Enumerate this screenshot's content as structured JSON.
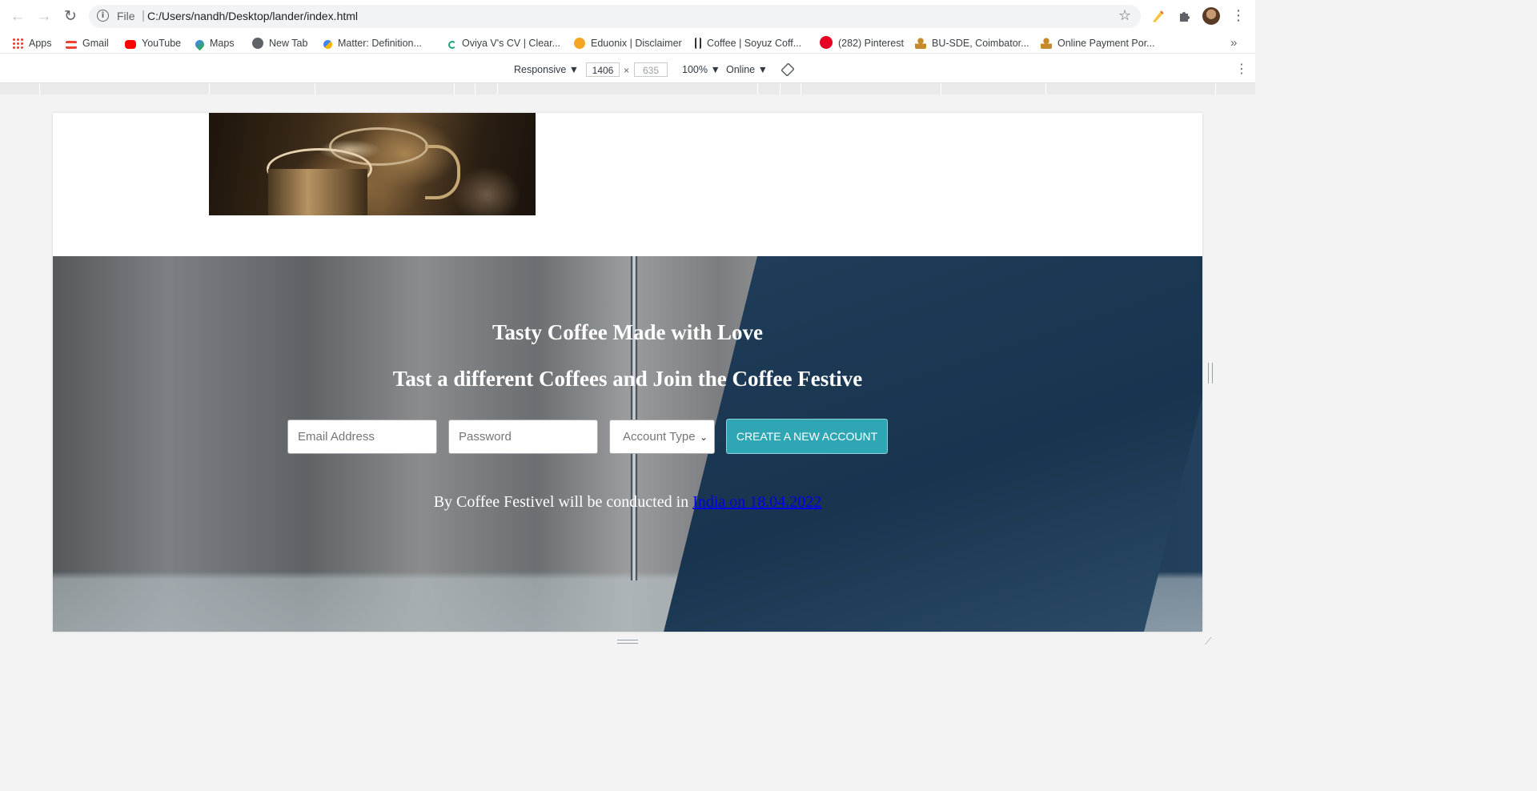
{
  "browser": {
    "omnibox": {
      "scheme": "File",
      "url": "C:/Users/nandh/Desktop/lander/index.html"
    },
    "icons": {
      "back": "arrow-left-icon",
      "forward": "arrow-right-icon",
      "reload": "reload-icon",
      "bookmark": "star-icon",
      "extensions": "puzzle-icon",
      "menu": "more-vert-icon"
    }
  },
  "bookmarks": [
    {
      "label": "Apps",
      "icon": "apps-grid-icon",
      "color": "#ea4335"
    },
    {
      "label": "Gmail",
      "icon": "gmail-icon",
      "color": "#ea4335"
    },
    {
      "label": "YouTube",
      "icon": "youtube-icon",
      "color": "#ff0000"
    },
    {
      "label": "Maps",
      "icon": "maps-pin-icon",
      "color": "#34a853"
    },
    {
      "label": "New Tab",
      "icon": "globe-icon",
      "color": "#5f6368"
    },
    {
      "label": "Matter: Definition...",
      "icon": "site-icon",
      "color": "#f4b400"
    },
    {
      "label": "Oviya V's CV | Clear...",
      "icon": "site-icon",
      "color": "#1aa67b"
    },
    {
      "label": "Eduonix | Disclaimer",
      "icon": "site-icon",
      "color": "#f4a524"
    },
    {
      "label": "Coffee | Soyuz Coff...",
      "icon": "site-icon",
      "color": "#333333"
    },
    {
      "label": "(282) Pinterest",
      "icon": "pinterest-icon",
      "color": "#e60023"
    },
    {
      "label": "BU-SDE, Coimbator...",
      "icon": "site-icon",
      "color": "#c58b2b"
    },
    {
      "label": "Online Payment Por...",
      "icon": "site-icon",
      "color": "#c58b2b"
    }
  ],
  "devtools": {
    "device": "Responsive ▼",
    "width": "1406",
    "height": "635",
    "zoom": "100% ▼",
    "network": "Online ▼",
    "x_sep": "×"
  },
  "page": {
    "hero": {
      "title": "Tasty Coffee Made with Love",
      "subtitle": "Tast a different Coffees and Join the Coffee Festive",
      "email_placeholder": "Email Address",
      "password_placeholder": "Password",
      "account_type": "Account Type",
      "create_button": "CREATE A NEW ACCOUNT",
      "note_prefix": "By Coffee Festivel will be conducted in ",
      "note_link": "India on 18.04.2022"
    }
  },
  "colors": {
    "accent_button": "#2ea6b3",
    "link": "#0000ee"
  }
}
